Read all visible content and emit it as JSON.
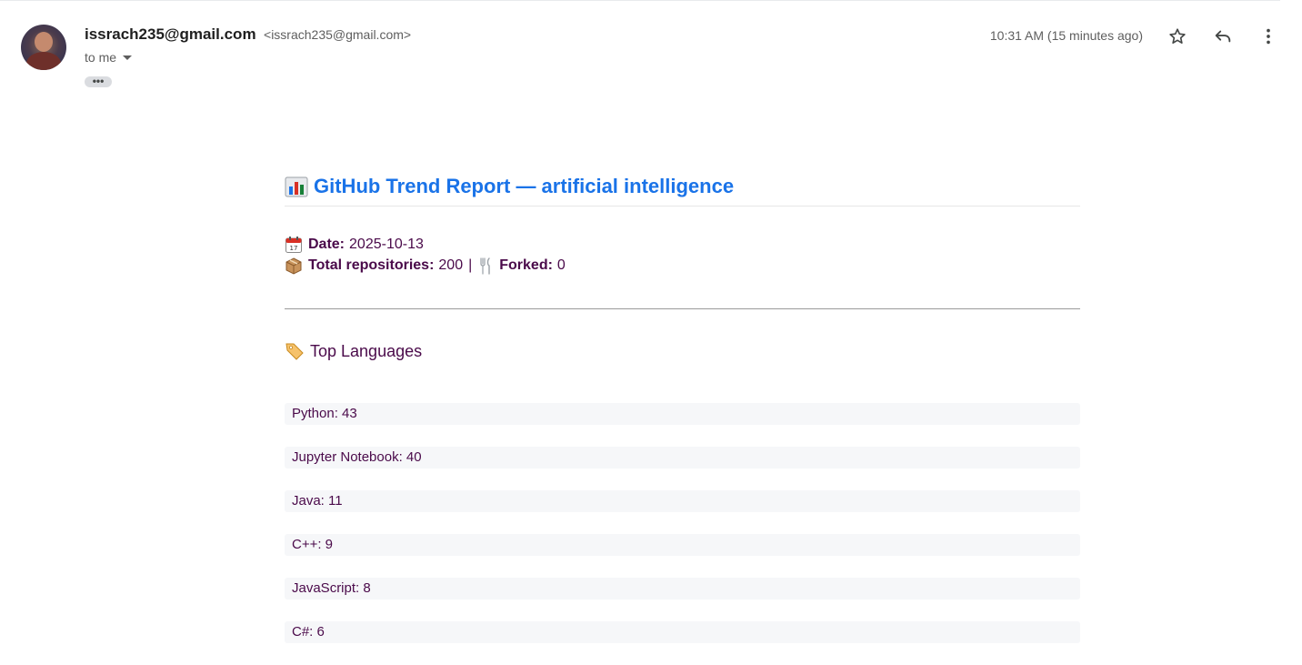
{
  "sender": {
    "name": "issrach235@gmail.com",
    "email": "<issrach235@gmail.com>",
    "recipient": "to me",
    "ellipsis": "•••"
  },
  "timestamp": "10:31 AM (15 minutes ago)",
  "icons": {
    "star": "star-icon",
    "reply": "reply-icon",
    "more": "more-vert-icon"
  },
  "report": {
    "title_emoji": "📊",
    "title": "GitHub Trend Report — artificial intelligence",
    "date_emoji": "📅",
    "date_label": "Date:",
    "date_value": "2025-10-13",
    "repos_emoji": "📦",
    "repos_label": "Total repositories:",
    "repos_value": "200",
    "separator": "|",
    "forked_emoji": "🍴",
    "forked_label": "Forked:",
    "forked_value": "0",
    "languages_emoji": "🏷️",
    "languages_title": "Top Languages",
    "languages": [
      "Python: 43",
      "Jupyter Notebook: 40",
      "Java: 11",
      "C++: 9",
      "JavaScript: 8",
      "C#: 6"
    ]
  },
  "colors": {
    "title_blue": "#1a73e8",
    "body_text": "#4a0a4a",
    "item_bg": "#f6f7f9"
  }
}
